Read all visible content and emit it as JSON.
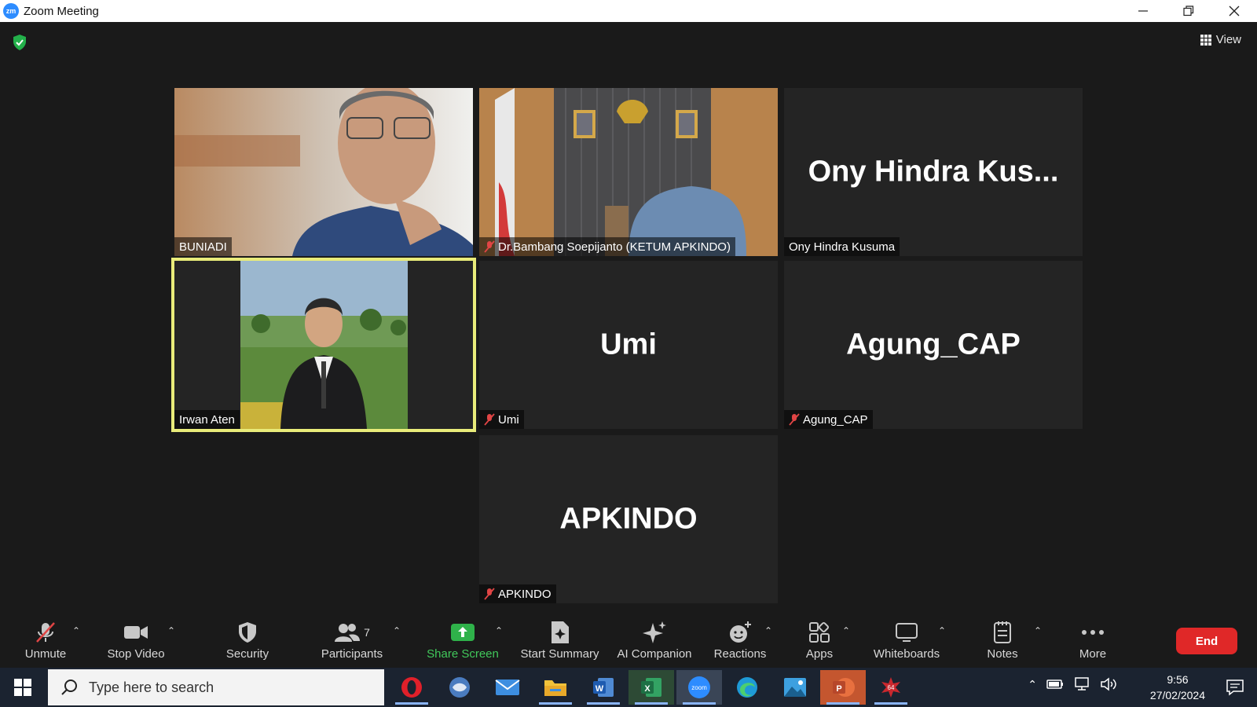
{
  "window": {
    "app_logo": "zm",
    "title": "Zoom Meeting",
    "minimize_icon": "minimize-icon",
    "restore_icon": "restore-icon",
    "close_icon": "close-icon"
  },
  "meeting": {
    "security_indicator": "shield-check-icon",
    "view_label": "View"
  },
  "tiles": [
    {
      "id": "buniadi",
      "label": "BUNIADI",
      "big_name": "",
      "muted": false,
      "has_video": true,
      "active": false
    },
    {
      "id": "bambang",
      "label": "Dr.Bambang Soepijanto (KETUM APKINDO)",
      "big_name": "",
      "muted": true,
      "has_video": true,
      "active": false
    },
    {
      "id": "ony",
      "label": "Ony Hindra Kusuma",
      "big_name": "Ony  Hindra  Kus...",
      "muted": false,
      "has_video": false,
      "active": false
    },
    {
      "id": "irwan",
      "label": "Irwan Aten",
      "big_name": "",
      "muted": false,
      "has_video": true,
      "active": true
    },
    {
      "id": "umi",
      "label": "Umi",
      "big_name": "Umi",
      "muted": true,
      "has_video": false,
      "active": false
    },
    {
      "id": "agung",
      "label": "Agung_CAP",
      "big_name": "Agung_CAP",
      "muted": true,
      "has_video": false,
      "active": false
    },
    {
      "id": "apkindo",
      "label": "APKINDO",
      "big_name": "APKINDO",
      "muted": true,
      "has_video": false,
      "active": false
    }
  ],
  "toolbar": {
    "unmute": "Unmute",
    "stop_video": "Stop Video",
    "security": "Security",
    "participants": "Participants",
    "participants_count": "7",
    "share_screen": "Share Screen",
    "start_summary": "Start Summary",
    "ai_companion": "AI Companion",
    "reactions": "Reactions",
    "apps": "Apps",
    "whiteboards": "Whiteboards",
    "notes": "Notes",
    "more": "More",
    "end": "End"
  },
  "taskbar": {
    "search_placeholder": "Type here to search",
    "apps": [
      "opera-icon",
      "app-icon",
      "mail-icon",
      "file-explorer-icon",
      "word-icon",
      "excel-icon",
      "zoom-icon",
      "edge-icon",
      "photos-icon",
      "powerpoint-icon",
      "app-badge-icon"
    ],
    "zoom_label": "zoom",
    "badge_label": "64",
    "time": "9:56",
    "date": "27/02/2024"
  },
  "colors": {
    "share_green": "#41c95b",
    "end_red": "#e02828",
    "active_border": "#e9ec7a",
    "tile_bg": "#242424"
  }
}
